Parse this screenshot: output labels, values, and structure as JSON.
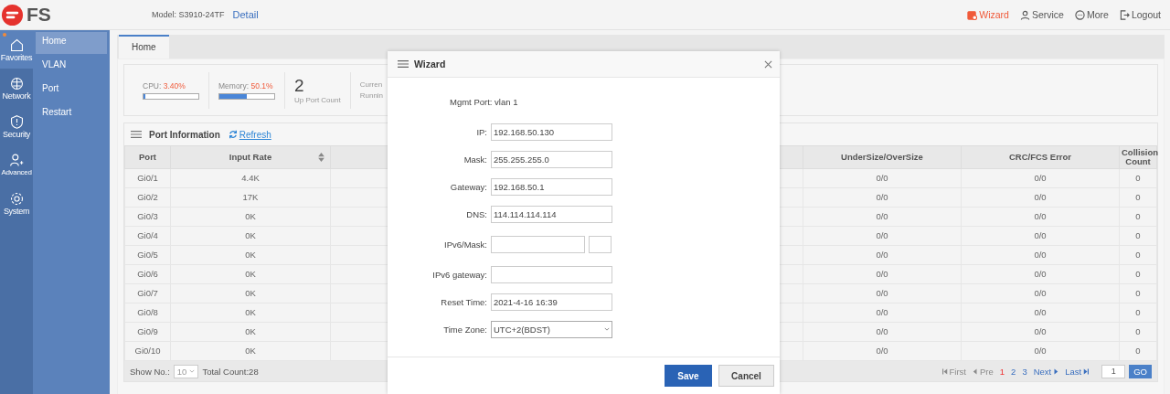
{
  "header": {
    "brand": "FS",
    "model": "Model: S3910-24TF",
    "detail_link": "Detail",
    "actions": [
      {
        "label": "Wizard",
        "active": true
      },
      {
        "label": "Service",
        "active": false
      },
      {
        "label": "More",
        "active": false
      },
      {
        "label": "Logout",
        "active": false
      }
    ]
  },
  "nav": [
    {
      "label": "Favorites",
      "selected": true
    },
    {
      "label": "Network",
      "selected": false
    },
    {
      "label": "Security",
      "selected": false
    },
    {
      "label": "Advanced",
      "selected": false
    },
    {
      "label": "System",
      "selected": false
    }
  ],
  "submenu": [
    {
      "label": "Home",
      "selected": true
    },
    {
      "label": "VLAN",
      "selected": false
    },
    {
      "label": "Port",
      "selected": false
    },
    {
      "label": "Restart",
      "selected": false
    }
  ],
  "tabs": [
    {
      "label": "Home",
      "selected": true
    }
  ],
  "stats": {
    "cpu": {
      "label": "CPU:",
      "value": "3.40%",
      "level": 0.034
    },
    "memory": {
      "label": "Memory:",
      "value": "50.1%",
      "level": 0.501
    },
    "up_port_count": "2",
    "up_port_label": "Up Port Count",
    "cut_lines": [
      "Curren",
      "Runnin"
    ]
  },
  "port_panel": {
    "title": "Port Information",
    "refresh": "Refresh",
    "columns": [
      "Port",
      "Input Rate",
      "",
      "UnderSize/OverSize",
      "CRC/FCS Error",
      "Collision Count"
    ],
    "rows": [
      [
        "Gi0/1",
        "4.4K",
        "",
        "0/0",
        "0/0",
        "0"
      ],
      [
        "Gi0/2",
        "17K",
        "",
        "0/0",
        "0/0",
        "0"
      ],
      [
        "Gi0/3",
        "0K",
        "",
        "0/0",
        "0/0",
        "0"
      ],
      [
        "Gi0/4",
        "0K",
        "",
        "0/0",
        "0/0",
        "0"
      ],
      [
        "Gi0/5",
        "0K",
        "",
        "0/0",
        "0/0",
        "0"
      ],
      [
        "Gi0/6",
        "0K",
        "",
        "0/0",
        "0/0",
        "0"
      ],
      [
        "Gi0/7",
        "0K",
        "",
        "0/0",
        "0/0",
        "0"
      ],
      [
        "Gi0/8",
        "0K",
        "",
        "0/0",
        "0/0",
        "0"
      ],
      [
        "Gi0/9",
        "0K",
        "",
        "0/0",
        "0/0",
        "0"
      ],
      [
        "Gi0/10",
        "0K",
        "",
        "0/0",
        "0/0",
        "0"
      ]
    ],
    "show_label": "Show No.:",
    "page_size": "10",
    "total": "Total Count:28",
    "pager": [
      {
        "label": "First",
        "kind": "first",
        "disabled": true,
        "selected": false
      },
      {
        "label": "Pre",
        "kind": "prev",
        "disabled": true,
        "selected": false
      },
      {
        "label": "1",
        "kind": "page",
        "disabled": false,
        "selected": true
      },
      {
        "label": "2",
        "kind": "page",
        "disabled": false,
        "selected": false
      },
      {
        "label": "3",
        "kind": "page",
        "disabled": false,
        "selected": false
      },
      {
        "label": "Next",
        "kind": "next",
        "disabled": false,
        "selected": false
      },
      {
        "label": "Last",
        "kind": "last",
        "disabled": false,
        "selected": false
      }
    ],
    "goto_value": "1",
    "go": "GO"
  },
  "wizard": {
    "title": "Wizard",
    "mgmt_port": "Mgmt Port: vlan 1",
    "fields": [
      {
        "label": "IP:",
        "kind": "text",
        "value": "192.168.50.130"
      },
      {
        "label": "Mask:",
        "kind": "text",
        "value": "255.255.255.0"
      },
      {
        "label": "Gateway:",
        "kind": "text",
        "value": "192.168.50.1"
      },
      {
        "label": "DNS:",
        "kind": "text",
        "value": "114.114.114.114"
      },
      {
        "label": "IPv6/Mask:",
        "kind": "pair"
      },
      {
        "label": "IPv6 gateway:",
        "kind": "text"
      },
      {
        "label": "Reset Time:",
        "kind": "text",
        "value": "2021-4-16 16:39"
      },
      {
        "label": "Time Zone:",
        "kind": "select",
        "value": "UTC+2(BDST)"
      }
    ],
    "save": "Save",
    "cancel": "Cancel"
  }
}
